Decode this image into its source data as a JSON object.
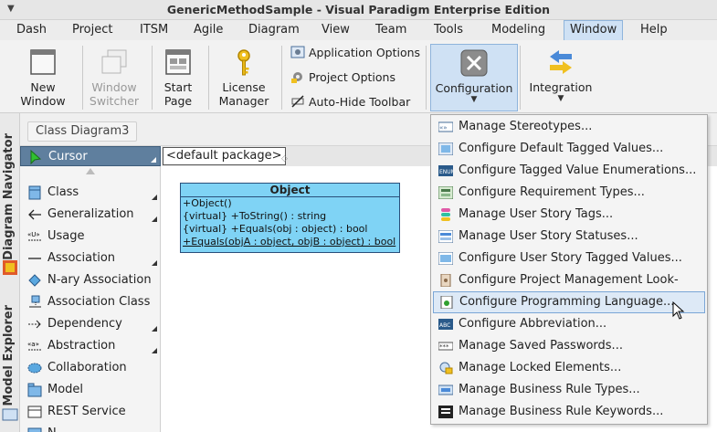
{
  "window": {
    "title": "GenericMethodSample - Visual Paradigm Enterprise Edition"
  },
  "menubar": {
    "items": [
      "Dash",
      "Project",
      "ITSM",
      "Agile",
      "Diagram",
      "View",
      "Team",
      "Tools",
      "Modeling",
      "Window",
      "Help"
    ],
    "active": "Window"
  },
  "toolbar": {
    "new_window": "New Window",
    "window_switcher": "Window Switcher",
    "start_page": "Start Page",
    "license_manager": "License Manager",
    "application_options": "Application Options",
    "project_options": "Project Options",
    "auto_hide_toolbar": "Auto-Hide Toolbar",
    "configuration": "Configuration",
    "integration": "Integration"
  },
  "side_tabs": {
    "diagram_navigator": "Diagram Navigator",
    "model_explorer": "Model Explorer"
  },
  "breadcrumb": "Class Diagram3",
  "palette": {
    "items": [
      "Cursor",
      "Class",
      "Generalization",
      "Usage",
      "Association",
      "N-ary Association",
      "Association Class",
      "Dependency",
      "Abstraction",
      "Collaboration",
      "Model",
      "REST Service",
      "N..."
    ]
  },
  "canvas": {
    "package": "<default package>",
    "class": {
      "name": "Object",
      "operations": [
        "+Object()",
        "{virtual} +ToString() : string",
        "{virtual} +Equals(obj : object) : bool",
        "+Equals(objA : object, objB : object) : bool"
      ]
    }
  },
  "configuration_menu": {
    "items": [
      "Manage Stereotypes...",
      "Configure Default Tagged Values...",
      "Configure Tagged Value Enumerations...",
      "Configure Requirement Types...",
      "Manage User Story Tags...",
      "Manage User Story Statuses...",
      "Configure User Story Tagged Values...",
      "Configure Project Management Look-ups...",
      "Configure Programming Language...",
      "Configure Abbreviation...",
      "Manage Saved Passwords...",
      "Manage Locked Elements...",
      "Manage Business Rule Types...",
      "Manage Business Rule Keywords..."
    ],
    "hovered": "Configure Programming Language..."
  },
  "colors": {
    "class_fill": "#7fd3f5",
    "selection": "#cfe1f4",
    "palette_selected": "#5f7f9e"
  }
}
